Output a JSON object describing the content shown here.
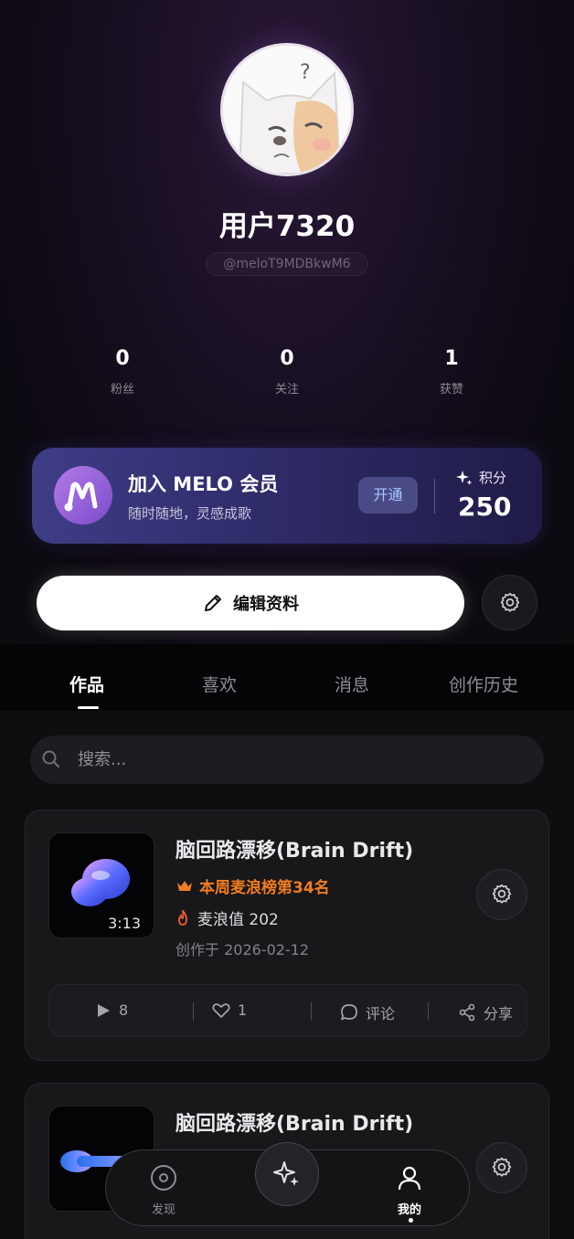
{
  "profile": {
    "display_name": "用户7320",
    "handle": "@meloT9MDBkwM6",
    "avatar_icon": "cat-avatar-icon"
  },
  "stats": [
    {
      "value": "0",
      "label": "粉丝"
    },
    {
      "value": "0",
      "label": "关注"
    },
    {
      "value": "1",
      "label": "获赞"
    }
  ],
  "membership": {
    "title": "加入 MELO 会员",
    "subtitle": "随时随地，灵感成歌",
    "open_label": "开通",
    "points_label": "积分",
    "points_value": "250",
    "accent": "#aac7ff"
  },
  "edit_profile_label": "编辑资料",
  "tabs": [
    {
      "label": "作品",
      "active": true
    },
    {
      "label": "喜欢",
      "active": false
    },
    {
      "label": "消息",
      "active": false
    },
    {
      "label": "创作历史",
      "active": false
    }
  ],
  "search": {
    "placeholder": "搜索..."
  },
  "works": [
    {
      "title": "脑回路漂移(Brain Drift)",
      "duration": "3:13",
      "rank": "本周麦浪榜第34名",
      "heat_label": "麦浪值 202",
      "created": "创作于 2026-02-12",
      "plays": "8",
      "likes": "1",
      "comment_label": "评论",
      "share_label": "分享",
      "rank_color": "#f07c24"
    },
    {
      "title": "脑回路漂移(Brain Drift)"
    }
  ],
  "nav": {
    "discover_label": "发现",
    "mine_label": "我的"
  }
}
